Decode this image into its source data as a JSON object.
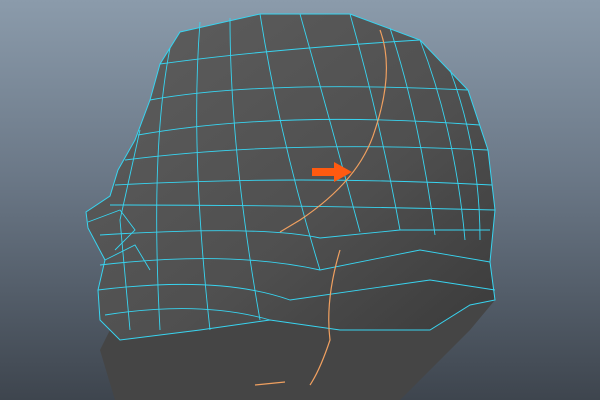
{
  "viewport": {
    "type": "3d-modeling-viewport",
    "object": "head-mesh",
    "colors": {
      "background_top": "#8b9bab",
      "background_bottom": "#3e454e",
      "mesh": "#555555",
      "wireframe": "#38d4f0",
      "selected_edge_loop": "#f0a060",
      "arrow": "#ff5a10"
    },
    "icons": [
      "arrow-right-icon"
    ]
  }
}
